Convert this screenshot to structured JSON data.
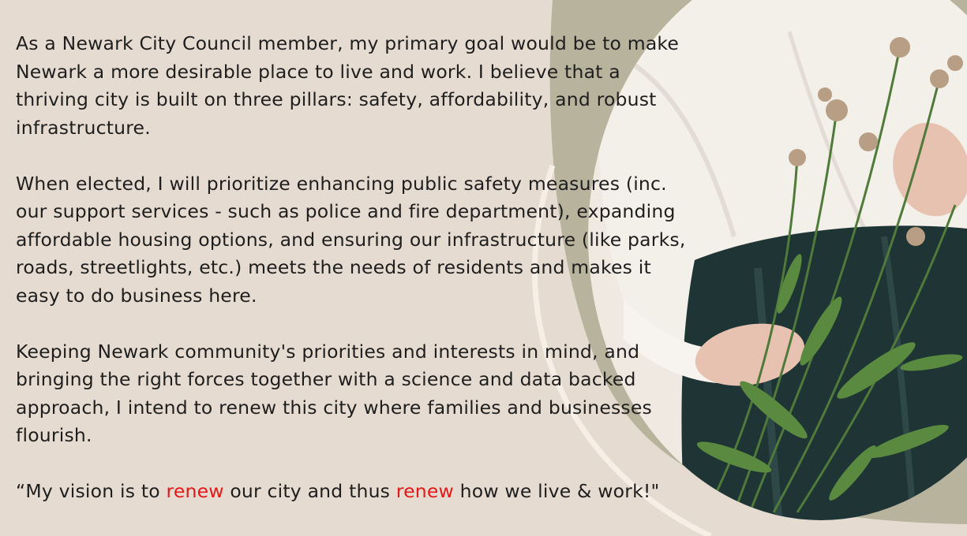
{
  "colors": {
    "background": "#e6dbd1",
    "olive_shape": "#b7b39d",
    "cream_arc": "#f7efe6",
    "text": "#1e1e1e",
    "accent": "#e51717",
    "blouse": "#f3efe9",
    "skirt": "#1f3434",
    "leaf": "#4f7a3a"
  },
  "paragraphs": [
    "As a Newark City Council member, my primary goal would be to make Newark a more desirable place to live and work. I believe that a thriving city is built on three pillars: safety, affordability, and robust infrastructure.",
    "When elected, I will prioritize enhancing public safety measures (inc. our support services - such as police and fire department), expanding affordable housing options, and ensuring our infrastructure (like parks, roads, streetlights, etc.) meets the needs of residents and makes it easy to do business here.",
    "Keeping Newark community's priorities and interests in mind, and bringing the right forces together with a science and data backed approach, I intend to renew this city where families and businesses flourish."
  ],
  "quote": {
    "part1": "“My vision is to ",
    "highlight1": "renew",
    "part2": " our city and thus ",
    "highlight2": "renew",
    "part3": " how we live & work!\""
  }
}
